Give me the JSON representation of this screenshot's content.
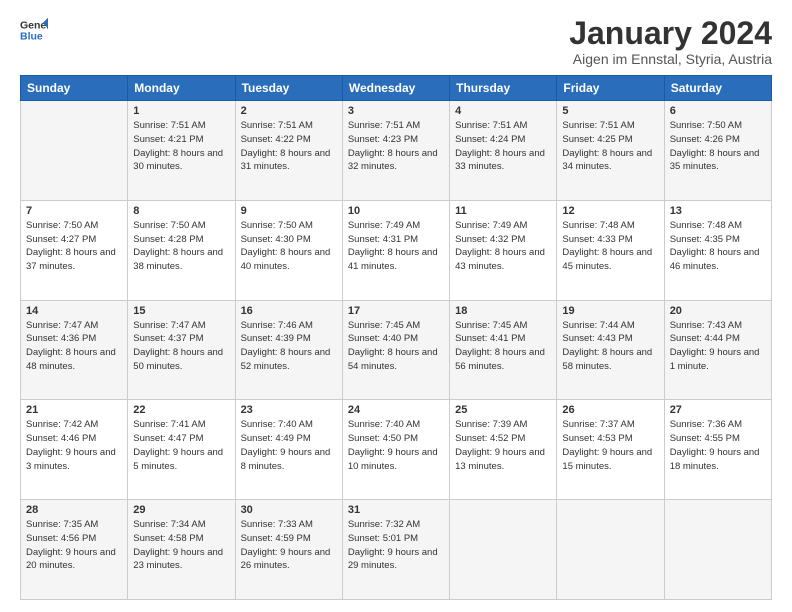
{
  "logo": {
    "line1": "General",
    "line2": "Blue"
  },
  "title": "January 2024",
  "subtitle": "Aigen im Ennstal, Styria, Austria",
  "weekdays": [
    "Sunday",
    "Monday",
    "Tuesday",
    "Wednesday",
    "Thursday",
    "Friday",
    "Saturday"
  ],
  "weeks": [
    [
      {
        "day": "",
        "sunrise": "",
        "sunset": "",
        "daylight": ""
      },
      {
        "day": "1",
        "sunrise": "Sunrise: 7:51 AM",
        "sunset": "Sunset: 4:21 PM",
        "daylight": "Daylight: 8 hours and 30 minutes."
      },
      {
        "day": "2",
        "sunrise": "Sunrise: 7:51 AM",
        "sunset": "Sunset: 4:22 PM",
        "daylight": "Daylight: 8 hours and 31 minutes."
      },
      {
        "day": "3",
        "sunrise": "Sunrise: 7:51 AM",
        "sunset": "Sunset: 4:23 PM",
        "daylight": "Daylight: 8 hours and 32 minutes."
      },
      {
        "day": "4",
        "sunrise": "Sunrise: 7:51 AM",
        "sunset": "Sunset: 4:24 PM",
        "daylight": "Daylight: 8 hours and 33 minutes."
      },
      {
        "day": "5",
        "sunrise": "Sunrise: 7:51 AM",
        "sunset": "Sunset: 4:25 PM",
        "daylight": "Daylight: 8 hours and 34 minutes."
      },
      {
        "day": "6",
        "sunrise": "Sunrise: 7:50 AM",
        "sunset": "Sunset: 4:26 PM",
        "daylight": "Daylight: 8 hours and 35 minutes."
      }
    ],
    [
      {
        "day": "7",
        "sunrise": "Sunrise: 7:50 AM",
        "sunset": "Sunset: 4:27 PM",
        "daylight": "Daylight: 8 hours and 37 minutes."
      },
      {
        "day": "8",
        "sunrise": "Sunrise: 7:50 AM",
        "sunset": "Sunset: 4:28 PM",
        "daylight": "Daylight: 8 hours and 38 minutes."
      },
      {
        "day": "9",
        "sunrise": "Sunrise: 7:50 AM",
        "sunset": "Sunset: 4:30 PM",
        "daylight": "Daylight: 8 hours and 40 minutes."
      },
      {
        "day": "10",
        "sunrise": "Sunrise: 7:49 AM",
        "sunset": "Sunset: 4:31 PM",
        "daylight": "Daylight: 8 hours and 41 minutes."
      },
      {
        "day": "11",
        "sunrise": "Sunrise: 7:49 AM",
        "sunset": "Sunset: 4:32 PM",
        "daylight": "Daylight: 8 hours and 43 minutes."
      },
      {
        "day": "12",
        "sunrise": "Sunrise: 7:48 AM",
        "sunset": "Sunset: 4:33 PM",
        "daylight": "Daylight: 8 hours and 45 minutes."
      },
      {
        "day": "13",
        "sunrise": "Sunrise: 7:48 AM",
        "sunset": "Sunset: 4:35 PM",
        "daylight": "Daylight: 8 hours and 46 minutes."
      }
    ],
    [
      {
        "day": "14",
        "sunrise": "Sunrise: 7:47 AM",
        "sunset": "Sunset: 4:36 PM",
        "daylight": "Daylight: 8 hours and 48 minutes."
      },
      {
        "day": "15",
        "sunrise": "Sunrise: 7:47 AM",
        "sunset": "Sunset: 4:37 PM",
        "daylight": "Daylight: 8 hours and 50 minutes."
      },
      {
        "day": "16",
        "sunrise": "Sunrise: 7:46 AM",
        "sunset": "Sunset: 4:39 PM",
        "daylight": "Daylight: 8 hours and 52 minutes."
      },
      {
        "day": "17",
        "sunrise": "Sunrise: 7:45 AM",
        "sunset": "Sunset: 4:40 PM",
        "daylight": "Daylight: 8 hours and 54 minutes."
      },
      {
        "day": "18",
        "sunrise": "Sunrise: 7:45 AM",
        "sunset": "Sunset: 4:41 PM",
        "daylight": "Daylight: 8 hours and 56 minutes."
      },
      {
        "day": "19",
        "sunrise": "Sunrise: 7:44 AM",
        "sunset": "Sunset: 4:43 PM",
        "daylight": "Daylight: 8 hours and 58 minutes."
      },
      {
        "day": "20",
        "sunrise": "Sunrise: 7:43 AM",
        "sunset": "Sunset: 4:44 PM",
        "daylight": "Daylight: 9 hours and 1 minute."
      }
    ],
    [
      {
        "day": "21",
        "sunrise": "Sunrise: 7:42 AM",
        "sunset": "Sunset: 4:46 PM",
        "daylight": "Daylight: 9 hours and 3 minutes."
      },
      {
        "day": "22",
        "sunrise": "Sunrise: 7:41 AM",
        "sunset": "Sunset: 4:47 PM",
        "daylight": "Daylight: 9 hours and 5 minutes."
      },
      {
        "day": "23",
        "sunrise": "Sunrise: 7:40 AM",
        "sunset": "Sunset: 4:49 PM",
        "daylight": "Daylight: 9 hours and 8 minutes."
      },
      {
        "day": "24",
        "sunrise": "Sunrise: 7:40 AM",
        "sunset": "Sunset: 4:50 PM",
        "daylight": "Daylight: 9 hours and 10 minutes."
      },
      {
        "day": "25",
        "sunrise": "Sunrise: 7:39 AM",
        "sunset": "Sunset: 4:52 PM",
        "daylight": "Daylight: 9 hours and 13 minutes."
      },
      {
        "day": "26",
        "sunrise": "Sunrise: 7:37 AM",
        "sunset": "Sunset: 4:53 PM",
        "daylight": "Daylight: 9 hours and 15 minutes."
      },
      {
        "day": "27",
        "sunrise": "Sunrise: 7:36 AM",
        "sunset": "Sunset: 4:55 PM",
        "daylight": "Daylight: 9 hours and 18 minutes."
      }
    ],
    [
      {
        "day": "28",
        "sunrise": "Sunrise: 7:35 AM",
        "sunset": "Sunset: 4:56 PM",
        "daylight": "Daylight: 9 hours and 20 minutes."
      },
      {
        "day": "29",
        "sunrise": "Sunrise: 7:34 AM",
        "sunset": "Sunset: 4:58 PM",
        "daylight": "Daylight: 9 hours and 23 minutes."
      },
      {
        "day": "30",
        "sunrise": "Sunrise: 7:33 AM",
        "sunset": "Sunset: 4:59 PM",
        "daylight": "Daylight: 9 hours and 26 minutes."
      },
      {
        "day": "31",
        "sunrise": "Sunrise: 7:32 AM",
        "sunset": "Sunset: 5:01 PM",
        "daylight": "Daylight: 9 hours and 29 minutes."
      },
      {
        "day": "",
        "sunrise": "",
        "sunset": "",
        "daylight": ""
      },
      {
        "day": "",
        "sunrise": "",
        "sunset": "",
        "daylight": ""
      },
      {
        "day": "",
        "sunrise": "",
        "sunset": "",
        "daylight": ""
      }
    ]
  ]
}
